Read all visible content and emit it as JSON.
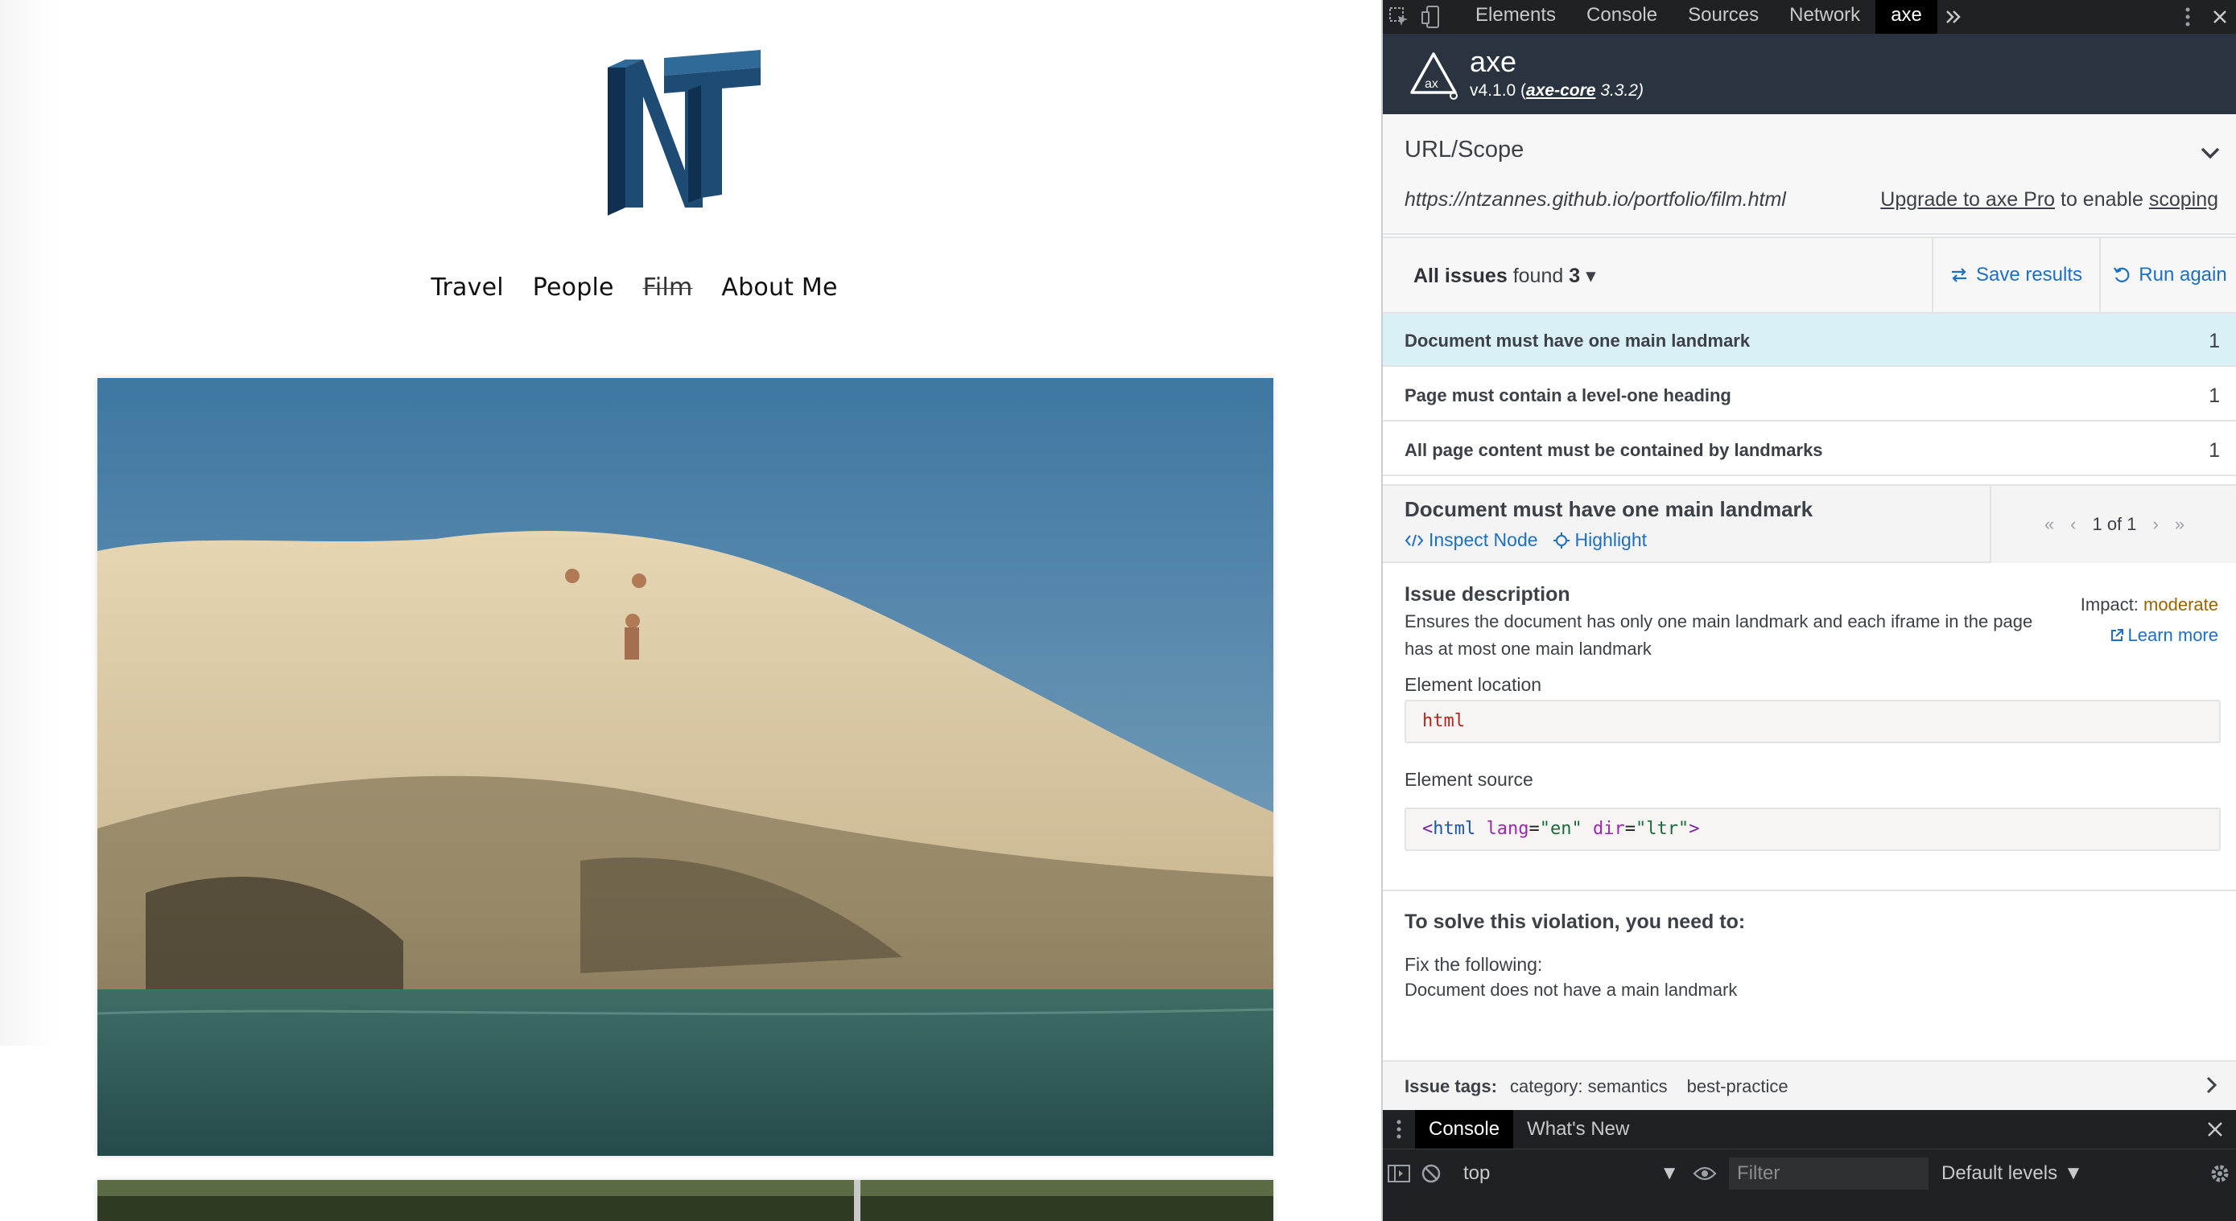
{
  "site": {
    "logo_text": "NT",
    "nav": [
      {
        "label": "Travel",
        "current": false
      },
      {
        "label": "People",
        "current": false
      },
      {
        "label": "Film",
        "current": true
      },
      {
        "label": "About Me",
        "current": false
      }
    ]
  },
  "devtools": {
    "tabs": [
      "Elements",
      "Console",
      "Sources",
      "Network",
      "axe"
    ],
    "active_tab": "axe",
    "more_tabs_icon": "double-chevron-right-icon"
  },
  "axe": {
    "name": "axe",
    "version_prefix": "v4.1.0 (",
    "core_link": "axe-core",
    "core_version": " 3.3.2)",
    "url_scope": {
      "title": "URL/Scope",
      "url": "https://ntzannes.github.io/portfolio/film.html",
      "upgrade_link": "Upgrade to axe Pro",
      "upgrade_mid": " to enable ",
      "scoping_link": "scoping"
    },
    "issues": {
      "label": "All issues",
      "found_text": "found",
      "count": "3",
      "save_label": "Save results",
      "run_label": "Run again",
      "list": [
        {
          "title": "Document must have one main landmark",
          "count": "1"
        },
        {
          "title": "Page must contain a level-one heading",
          "count": "1"
        },
        {
          "title": "All page content must be contained by landmarks",
          "count": "1"
        }
      ]
    },
    "detail": {
      "title": "Document must have one main landmark",
      "inspect_label": "Inspect Node",
      "highlight_label": "Highlight",
      "pager_text": "1 of 1",
      "desc_heading": "Issue description",
      "description": "Ensures the document has only one main landmark and each iframe in the page has at most one main landmark",
      "impact_label": "Impact:",
      "impact_value": "moderate",
      "learn_more": "Learn more",
      "location_heading": "Element location",
      "location_value": "html",
      "source_heading": "Element source",
      "source": {
        "open": "<",
        "tag": "html",
        "attr1": "lang",
        "val1": "\"en\"",
        "attr2": "dir",
        "val2": "\"ltr\"",
        "close": ">"
      },
      "solve_heading": "To solve this violation, you need to:",
      "fix_heading": "Fix the following:",
      "fix_item": "Document does not have a main landmark",
      "tags_label": "Issue tags:",
      "tags": [
        "category: semantics",
        "best-practice"
      ]
    }
  },
  "drawer": {
    "tabs": [
      "Console",
      "What's New"
    ],
    "active_tab": "Console",
    "context": "top",
    "filter_placeholder": "Filter",
    "levels": "Default levels"
  },
  "colors": {
    "accent_blue": "#1c6fc4",
    "selected_row": "#daf0f7",
    "axe_header": "#2a3440",
    "impact_moderate": "#996300"
  }
}
